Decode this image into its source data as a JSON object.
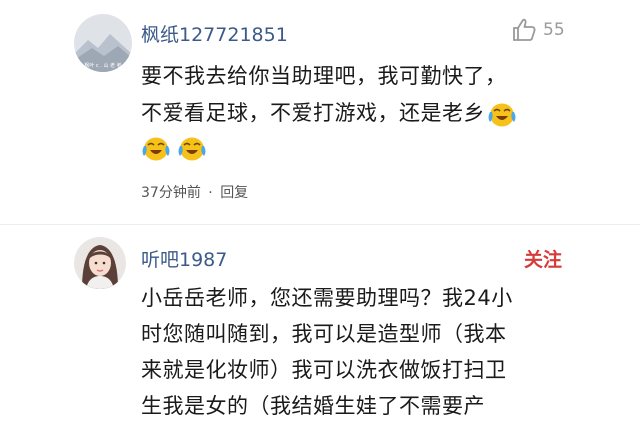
{
  "comments": [
    {
      "username": "枫纸127721851",
      "like_count": "55",
      "avatar_caption": "枫叶 c . 山 老 者",
      "lines": [
        "要不我去给你当助理吧，我可勤快了，",
        "不爱看足球，不爱打游戏，还是老乡"
      ],
      "time": "37分钟前",
      "separator": "·",
      "reply": "回复"
    },
    {
      "username": "听吧1987",
      "follow_label": "关注",
      "lines": [
        "小岳岳老师，您还需要助理吗？我24小",
        "时您随叫随到，我可以是造型师（我本",
        "来就是化妆师）我可以洗衣做饭打扫卫",
        "生我是女的（我结婚生娃了不需要产"
      ]
    }
  ],
  "colors": {
    "username": "#3b5a8a",
    "follow": "#d63b3b",
    "emoji_face": "#f6c21a",
    "tear": "#4aa8e8"
  },
  "icons": {
    "like": "thumbs-up-icon",
    "emoji": "laughing-crying-emoji"
  }
}
